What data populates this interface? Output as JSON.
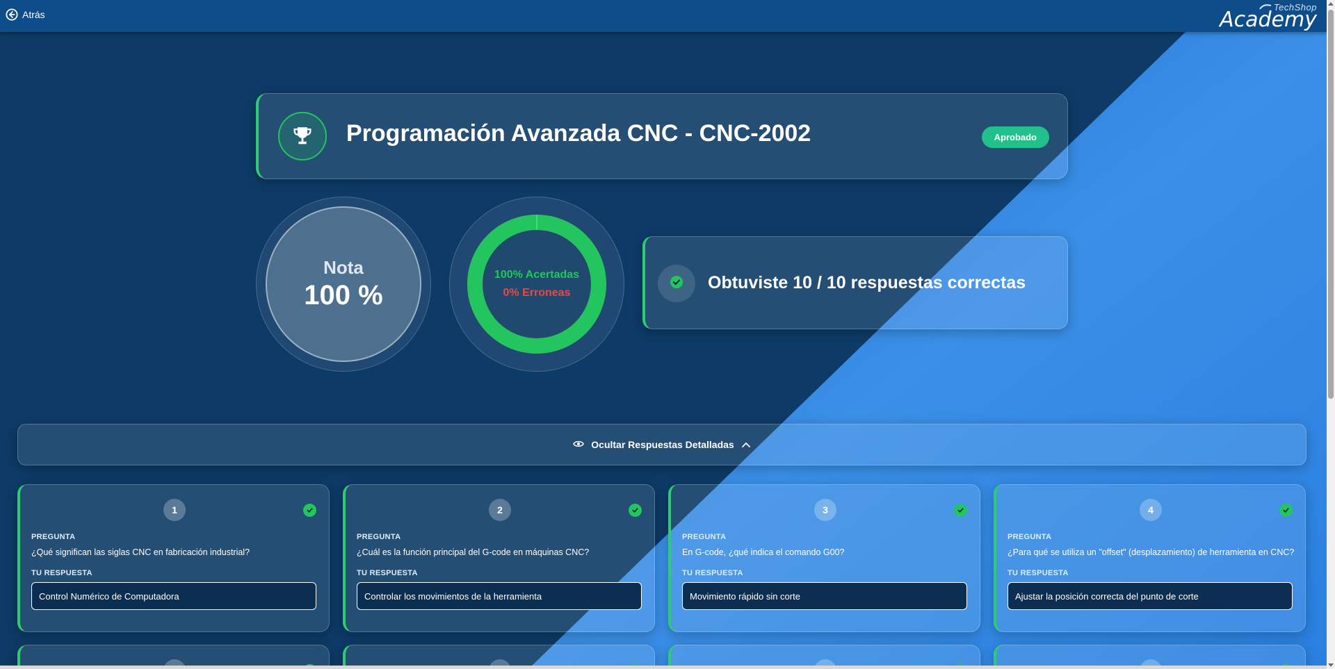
{
  "topbar": {
    "back_label": "Atrás",
    "logo_small": "TechShop",
    "logo_big": "Academy"
  },
  "course": {
    "title": "Programación Avanzada CNC - CNC-2002",
    "status": "Aprobado"
  },
  "grade": {
    "label": "Nota",
    "value": "100 %"
  },
  "results": {
    "correct_label": "100% Acertadas",
    "wrong_label": "0% Erroneas",
    "correct_fraction": 1.0
  },
  "summary": {
    "prefix": "Obtuviste",
    "score": "10 / 10",
    "suffix": "respuestas correctas"
  },
  "toggle": {
    "label": "Ocultar Respuestas Detalladas"
  },
  "labels": {
    "question": "PREGUNTA",
    "answer": "TU RESPUESTA"
  },
  "questions": [
    {
      "number": "1",
      "question": "¿Qué significan las siglas CNC en fabricación industrial?",
      "answer": "Control Numérico de Computadora"
    },
    {
      "number": "2",
      "question": "¿Cuál es la función principal del G-code en máquinas CNC?",
      "answer": "Controlar los movimientos de la herramienta"
    },
    {
      "number": "3",
      "question": "En G-code, ¿qué indica el comando G00?",
      "answer": "Movimiento rápido sin corte"
    },
    {
      "number": "4",
      "question": "¿Para qué se utiliza un \"offset\" (desplazamiento) de herramienta en CNC?",
      "answer": "Ajustar la posición correcta del punto de corte"
    }
  ],
  "colors": {
    "accent_green": "#22c55e",
    "error_red": "#ef4444",
    "badge_green": "#22c08a",
    "topbar_blue": "#0f4d8a"
  }
}
